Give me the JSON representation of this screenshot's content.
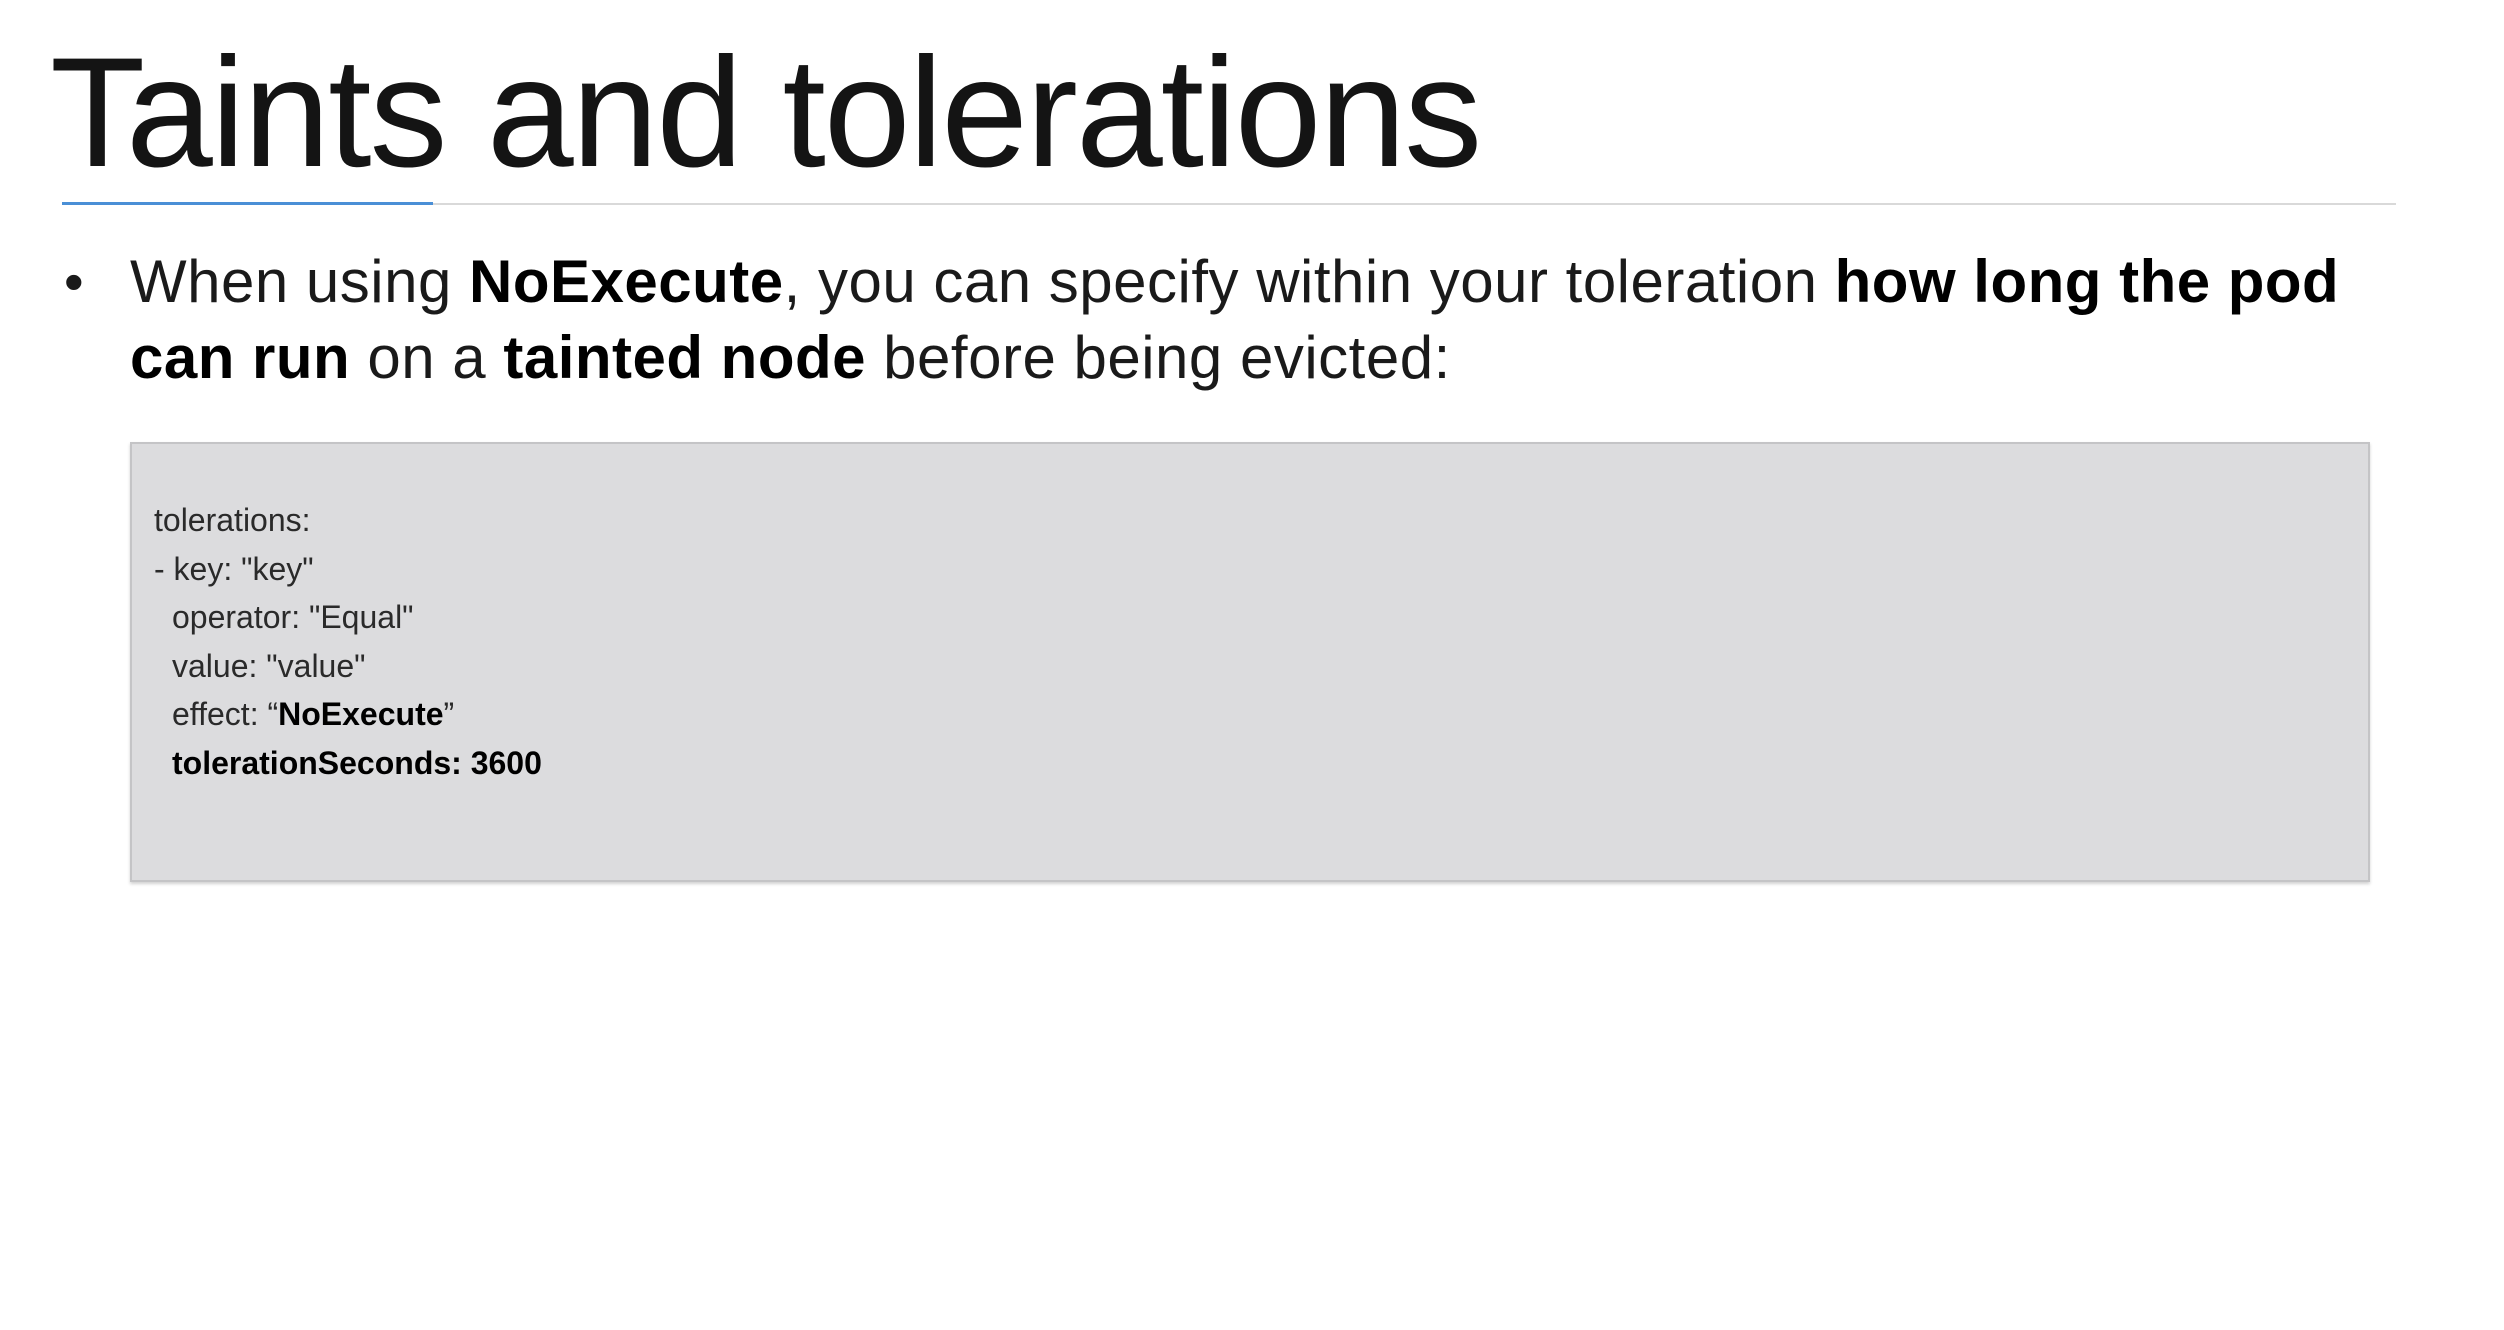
{
  "slide": {
    "title": "Taints and tolerations",
    "bullet": {
      "marker": "•",
      "segments": [
        {
          "text": "When using ",
          "bold": false
        },
        {
          "text": "NoExecute",
          "bold": true
        },
        {
          "text": ", you can specify within your toleration ",
          "bold": false
        },
        {
          "text": "how long the pod can run",
          "bold": true
        },
        {
          "text": " on a ",
          "bold": false
        },
        {
          "text": "tainted node",
          "bold": true
        },
        {
          "text": " before being evicted:",
          "bold": false
        }
      ]
    },
    "code": {
      "line1": "tolerations:",
      "line2": "- key: \"key\"",
      "line3": "operator: \"Equal\"",
      "line4": "value: \"value\"",
      "line5_prefix": "effect: “",
      "line5_bold": "NoExecute",
      "line5_suffix": "”",
      "line6": "tolerationSeconds: 3600"
    },
    "colors": {
      "accent_rule": "#4a8fd6",
      "code_background": "#dcdcde"
    }
  }
}
